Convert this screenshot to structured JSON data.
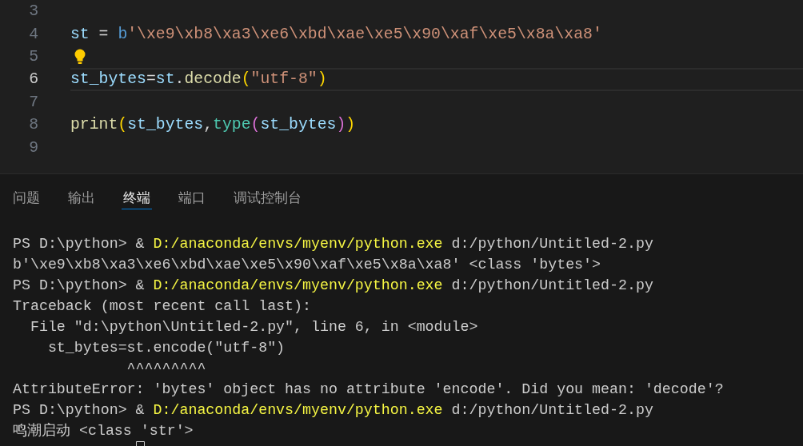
{
  "editor": {
    "lines": [
      {
        "number": "3",
        "current": false,
        "lightbulb": false
      },
      {
        "number": "4",
        "current": false,
        "lightbulb": false,
        "tokens": [
          {
            "text": "st",
            "kind": "variable"
          },
          {
            "text": " = ",
            "kind": "operator"
          },
          {
            "text": "b",
            "kind": "prefix"
          },
          {
            "text": "'\\xe9\\xb8\\xa3\\xe6\\xbd\\xae\\xe5\\x90\\xaf\\xe5\\x8a\\xa8'",
            "kind": "string"
          }
        ]
      },
      {
        "number": "5",
        "current": false,
        "lightbulb": true
      },
      {
        "number": "6",
        "current": true,
        "lightbulb": false,
        "tokens": [
          {
            "text": "st_bytes",
            "kind": "variable"
          },
          {
            "text": "=",
            "kind": "operator"
          },
          {
            "text": "st",
            "kind": "variable"
          },
          {
            "text": ".",
            "kind": "punct"
          },
          {
            "text": "decode",
            "kind": "function"
          },
          {
            "text": "(",
            "kind": "bracket"
          },
          {
            "text": "\"utf-8\"",
            "kind": "string"
          },
          {
            "text": ")",
            "kind": "bracket"
          }
        ]
      },
      {
        "number": "7",
        "current": false,
        "lightbulb": false
      },
      {
        "number": "8",
        "current": false,
        "lightbulb": false,
        "tokens": [
          {
            "text": "print",
            "kind": "function"
          },
          {
            "text": "(",
            "kind": "bracket"
          },
          {
            "text": "st_bytes",
            "kind": "variable"
          },
          {
            "text": ",",
            "kind": "punct"
          },
          {
            "text": "type",
            "kind": "type"
          },
          {
            "text": "(",
            "kind": "innerbracket"
          },
          {
            "text": "st_bytes",
            "kind": "variable"
          },
          {
            "text": ")",
            "kind": "innerbracket"
          },
          {
            "text": ")",
            "kind": "bracket"
          }
        ]
      },
      {
        "number": "9",
        "current": false,
        "lightbulb": false
      }
    ]
  },
  "panel": {
    "tabs": [
      {
        "label": "问题",
        "selected": false
      },
      {
        "label": "输出",
        "selected": false
      },
      {
        "label": "终端",
        "selected": true
      },
      {
        "label": "端口",
        "selected": false
      },
      {
        "label": "调试控制台",
        "selected": false
      }
    ]
  },
  "terminal": {
    "lines": [
      {
        "segments": [
          {
            "text": "PS D:\\python> & ",
            "kind": "plain"
          },
          {
            "text": "D:/anaconda/envs/myenv/python.exe",
            "kind": "command"
          },
          {
            "text": " d:/python/Untitled-2.py",
            "kind": "plain"
          }
        ]
      },
      {
        "segments": [
          {
            "text": "b'\\xe9\\xb8\\xa3\\xe6\\xbd\\xae\\xe5\\x90\\xaf\\xe5\\x8a\\xa8' <class 'bytes'>",
            "kind": "plain"
          }
        ]
      },
      {
        "segments": [
          {
            "text": "PS D:\\python> & ",
            "kind": "plain"
          },
          {
            "text": "D:/anaconda/envs/myenv/python.exe",
            "kind": "command"
          },
          {
            "text": " d:/python/Untitled-2.py",
            "kind": "plain"
          }
        ]
      },
      {
        "segments": [
          {
            "text": "Traceback (most recent call last):",
            "kind": "plain"
          }
        ]
      },
      {
        "segments": [
          {
            "text": "  File \"d:\\python\\Untitled-2.py\", line 6, in <module>",
            "kind": "plain"
          }
        ]
      },
      {
        "segments": [
          {
            "text": "    st_bytes=st.encode(\"utf-8\")",
            "kind": "plain"
          }
        ]
      },
      {
        "segments": [
          {
            "text": "             ^^^^^^^^^",
            "kind": "plain"
          }
        ]
      },
      {
        "segments": [
          {
            "text": "AttributeError: 'bytes' object has no attribute 'encode'. Did you mean: 'decode'?",
            "kind": "plain"
          }
        ]
      },
      {
        "segments": [
          {
            "text": "PS D:\\python> & ",
            "kind": "plain"
          },
          {
            "text": "D:/anaconda/envs/myenv/python.exe",
            "kind": "command"
          },
          {
            "text": " d:/python/Untitled-2.py",
            "kind": "plain"
          }
        ]
      },
      {
        "segments": [
          {
            "text": "鸣潮启动 <class 'str'>",
            "kind": "plain"
          }
        ]
      }
    ],
    "cursor": true
  }
}
